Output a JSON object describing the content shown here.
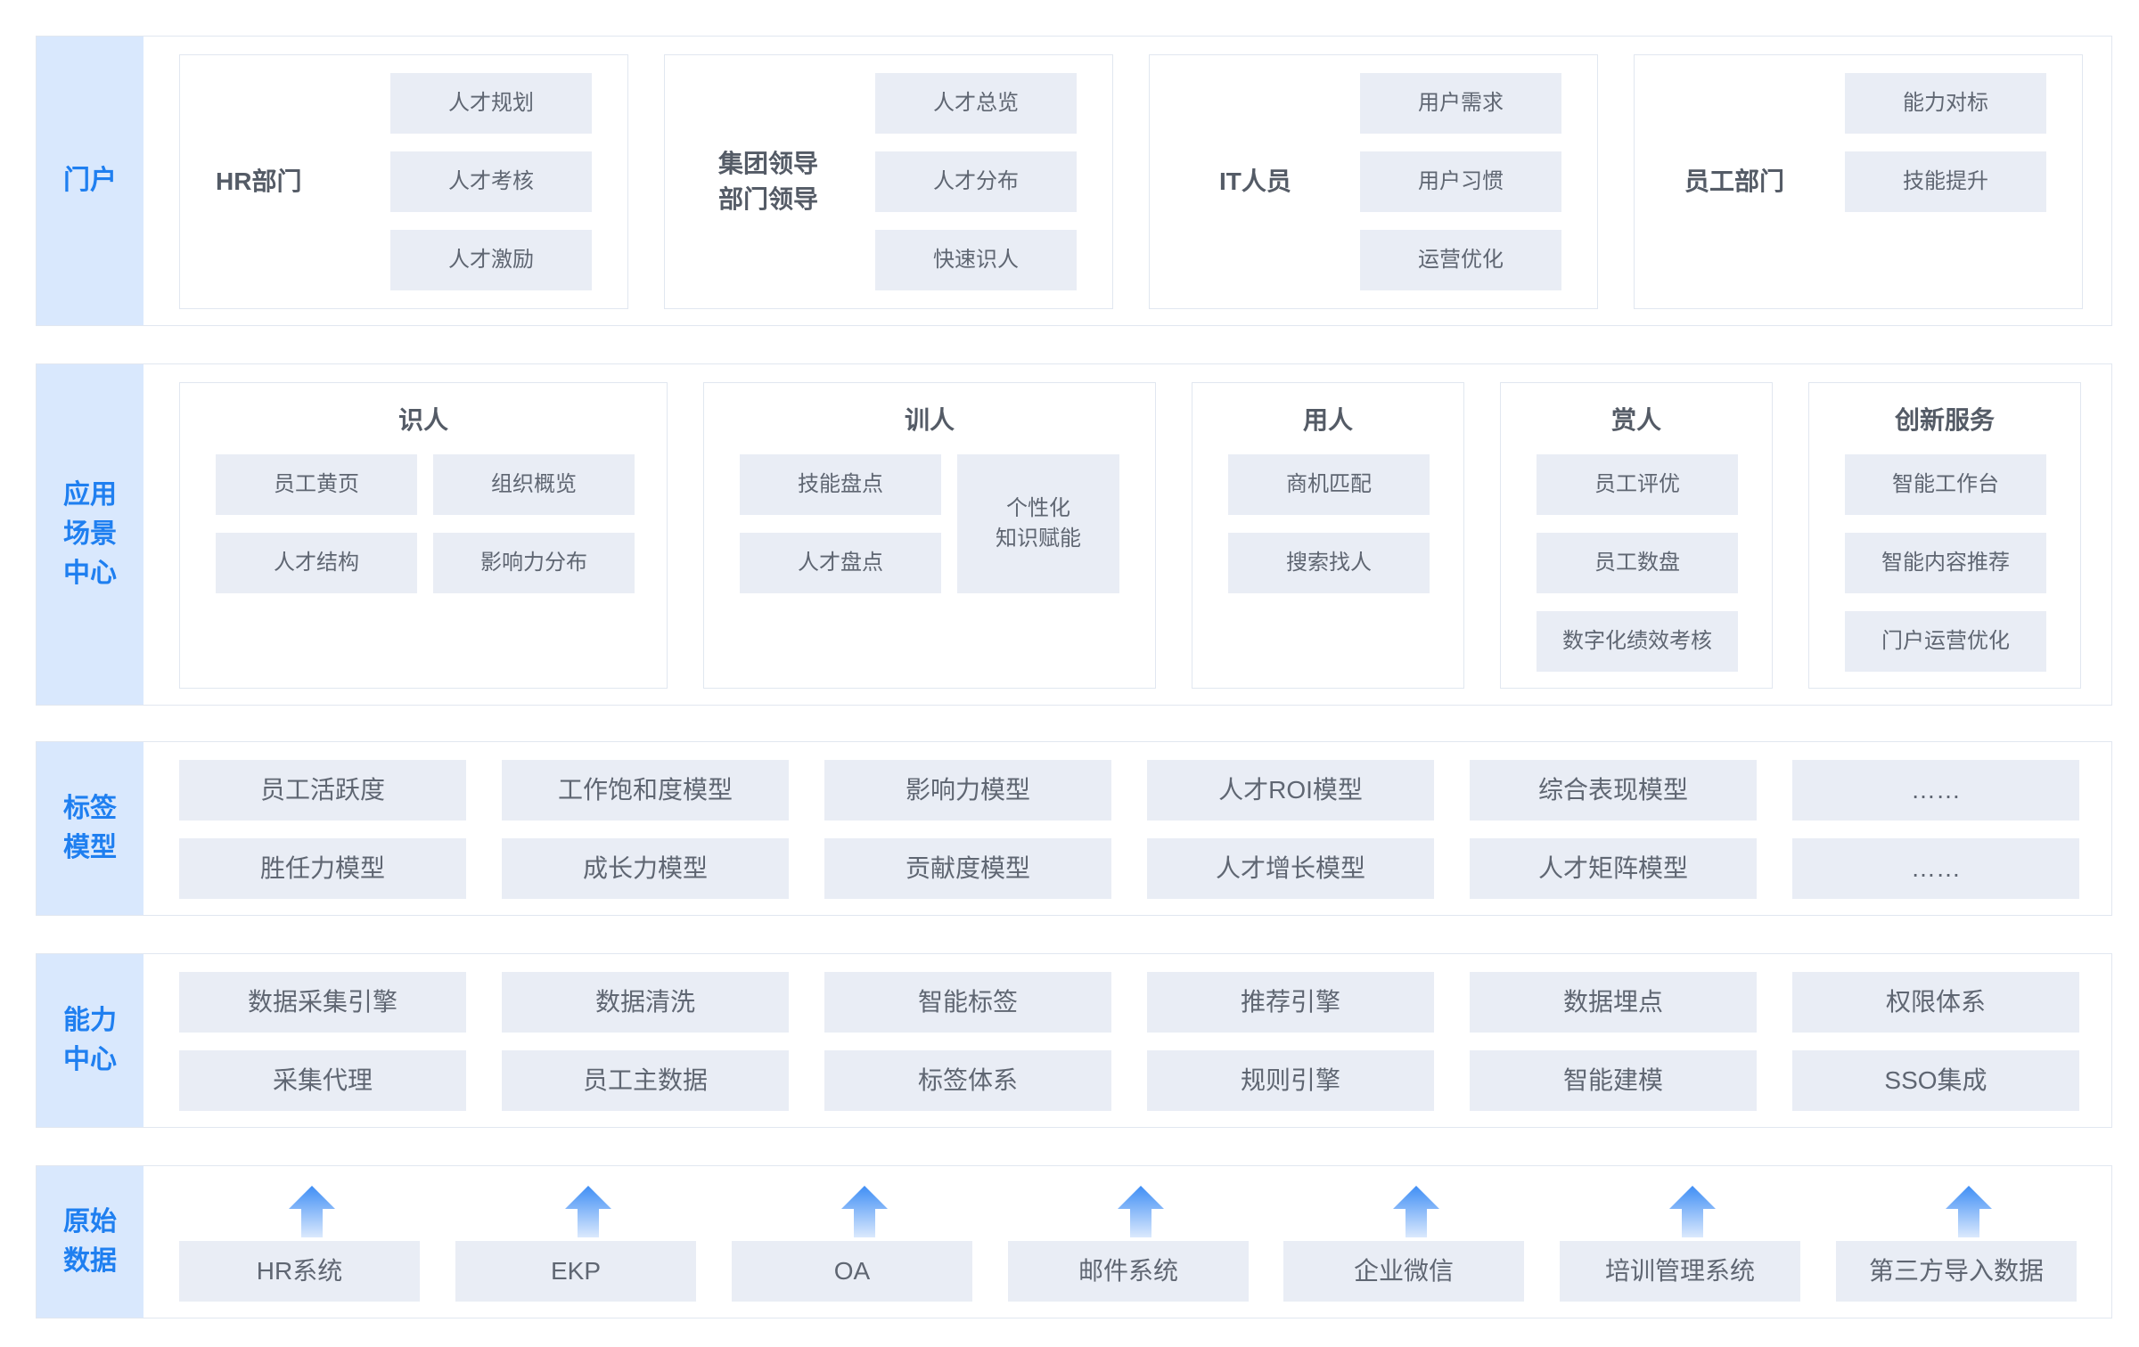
{
  "portal": {
    "label": "门户",
    "groups": [
      {
        "name": "HR部门",
        "items": [
          "人才规划",
          "人才考核",
          "人才激励"
        ]
      },
      {
        "name": "集团领导\n部门领导",
        "items": [
          "人才总览",
          "人才分布",
          "快速识人"
        ]
      },
      {
        "name": "IT人员",
        "items": [
          "用户需求",
          "用户习惯",
          "运营优化"
        ]
      },
      {
        "name": "员工部门",
        "items": [
          "能力对标",
          "技能提升"
        ]
      }
    ]
  },
  "application": {
    "label": "应用\n场景\n中心",
    "sections": [
      {
        "title": "识人",
        "items": [
          "员工黄页",
          "组织概览",
          "人才结构",
          "影响力分布"
        ]
      },
      {
        "title": "训人",
        "items": [
          "技能盘点",
          "人才盘点",
          "个性化\n知识赋能"
        ]
      },
      {
        "title": "用人",
        "items": [
          "商机匹配",
          "搜索找人"
        ]
      },
      {
        "title": "赏人",
        "items": [
          "员工评优",
          "员工数盘",
          "数字化绩效考核"
        ]
      },
      {
        "title": "创新服务",
        "items": [
          "智能工作台",
          "智能内容推荐",
          "门户运营优化"
        ]
      }
    ]
  },
  "tags": {
    "label": "标签\n模型",
    "row1": [
      "员工活跃度",
      "工作饱和度模型",
      "影响力模型",
      "人才ROI模型",
      "综合表现模型",
      "……"
    ],
    "row2": [
      "胜任力模型",
      "成长力模型",
      "贡献度模型",
      "人才增长模型",
      "人才矩阵模型",
      "……"
    ]
  },
  "capability": {
    "label": "能力\n中心",
    "row1": [
      "数据采集引擎",
      "数据清洗",
      "智能标签",
      "推荐引擎",
      "数据埋点",
      "权限体系"
    ],
    "row2": [
      "采集代理",
      "员工主数据",
      "标签体系",
      "规则引擎",
      "智能建模",
      "SSO集成"
    ]
  },
  "raw": {
    "label": "原始\n数据",
    "items": [
      "HR系统",
      "EKP",
      "OA",
      "邮件系统",
      "企业微信",
      "培训管理系统",
      "第三方导入数据"
    ]
  },
  "colors": {
    "accent": "#1f7ff0",
    "label_bg": "#d9e8fd",
    "chip_bg": "#e9edf5",
    "border": "#e1e7f0"
  }
}
